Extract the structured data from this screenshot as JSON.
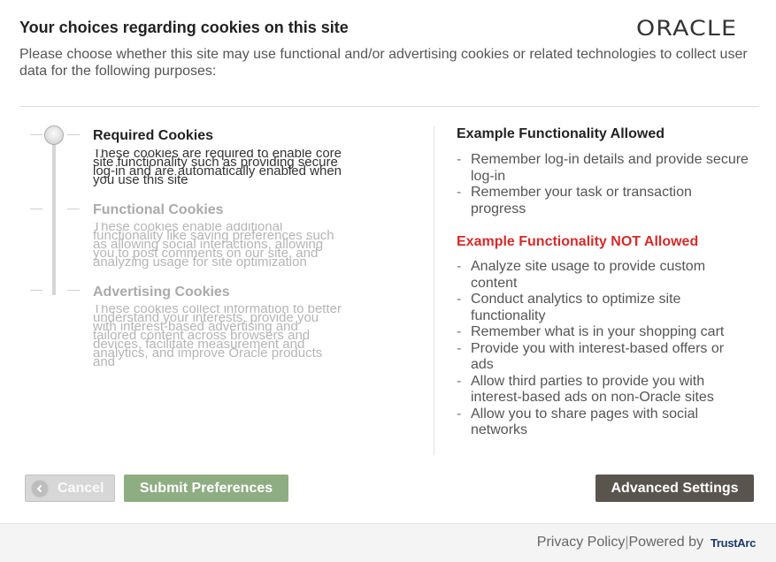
{
  "dialog": {
    "title": "Your choices regarding cookies on this site",
    "logo": "ORACLE",
    "intro": "Please choose whether this site may use functional and/or advertising cookies or related technologies to collect user data for the following purposes:"
  },
  "levels": [
    {
      "title": "Required Cookies",
      "description": "These cookies are required to enable core site functionality such as providing secure log-in and are automatically enabled when you use this site",
      "selected": true
    },
    {
      "title": "Functional Cookies",
      "description": "These cookies enable additional functionality like saving preferences such as allowing social interactions, allowing you to post comments on our site, and analyzing usage for site optimization",
      "selected": false
    },
    {
      "title": "Advertising Cookies",
      "description": "These cookies collect information to better understand your interests, provide you with interest-based advertising and tailored content across browsers and devices, facilitate measurement and analytics, and improve Oracle products and",
      "selected": false
    }
  ],
  "allowed": {
    "title": "Example Functionality Allowed",
    "items": [
      "Remember log-in details and provide secure log-in",
      "Remember your task or transaction progress"
    ]
  },
  "not_allowed": {
    "title": "Example Functionality NOT Allowed",
    "title_color": "#d42b2b",
    "items": [
      "Analyze site usage to provide custom content",
      "Conduct analytics to optimize site functionality",
      "Remember what is in your shopping cart",
      "Provide you with interest-based offers or ads",
      "Allow third parties to provide you with interest-based ads on non-Oracle sites",
      "Allow you to share pages with social networks"
    ]
  },
  "list_bullet": "-",
  "buttons": {
    "cancel": "Cancel",
    "submit": "Submit Preferences",
    "advanced": "Advanced Settings"
  },
  "footer": {
    "privacy": "Privacy Policy",
    "separator": "|",
    "powered_by": "Powered by",
    "brand": "TrustArc"
  },
  "icons": {
    "cancel": "back-arrow-circle-icon",
    "slider": "slider-knob-icon"
  },
  "colors": {
    "submit_button": "#8fad83",
    "advanced_button": "#5a544f",
    "cancel_button": "#d7d7d7"
  }
}
